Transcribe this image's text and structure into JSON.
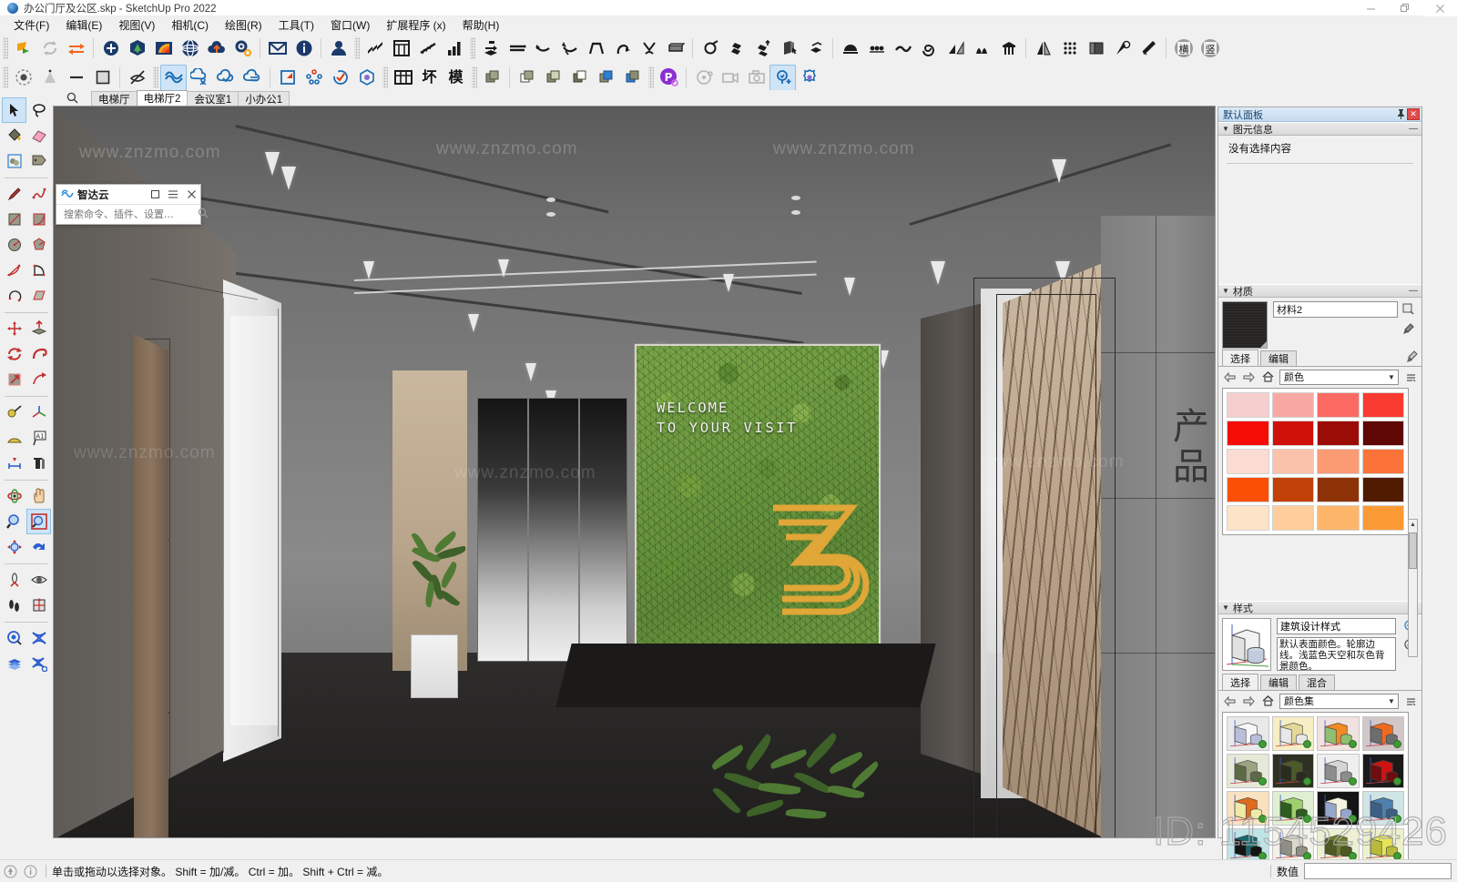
{
  "window": {
    "title": "办公门厅及公区.skp - SketchUp Pro 2022",
    "app_icon": "sketchup-app-icon",
    "minimize": "minimize-icon",
    "maximize": "restore-icon",
    "close": "close-icon"
  },
  "menu": [
    {
      "label": "文件(F)",
      "name": "menu-file"
    },
    {
      "label": "编辑(E)",
      "name": "menu-edit"
    },
    {
      "label": "视图(V)",
      "name": "menu-view"
    },
    {
      "label": "相机(C)",
      "name": "menu-camera"
    },
    {
      "label": "绘图(R)",
      "name": "menu-draw"
    },
    {
      "label": "工具(T)",
      "name": "menu-tools"
    },
    {
      "label": "窗口(W)",
      "name": "menu-window"
    },
    {
      "label": "扩展程序 (x)",
      "name": "menu-extensions"
    },
    {
      "label": "帮助(H)",
      "name": "menu-help"
    }
  ],
  "toolbar_row1": [
    {
      "name": "trimble-connect-icon",
      "glyph": "logo-green"
    },
    {
      "name": "sync-icon",
      "glyph": "refresh"
    },
    {
      "name": "transfer-icon",
      "glyph": "arrows-lr"
    },
    {
      "sep": true
    },
    {
      "name": "add-location-icon",
      "glyph": "plus-circle"
    },
    {
      "name": "tree-icon",
      "glyph": "tree"
    },
    {
      "name": "color-fan-icon",
      "glyph": "fan"
    },
    {
      "name": "globe-icon",
      "glyph": "globe"
    },
    {
      "name": "cloud-upload-icon",
      "glyph": "cloud-up"
    },
    {
      "name": "settings-icon",
      "glyph": "gears"
    },
    {
      "sep": true
    },
    {
      "name": "mail-icon",
      "glyph": "envelope"
    },
    {
      "name": "info-icon",
      "glyph": "info"
    },
    {
      "sep": true
    },
    {
      "name": "account-icon",
      "glyph": "person"
    },
    {
      "sep": true
    },
    {
      "name": "stairs-tool-icon",
      "glyph": "stairs"
    },
    {
      "name": "window-tool-icon",
      "glyph": "window"
    },
    {
      "name": "railing-tool-icon",
      "glyph": "railing"
    },
    {
      "name": "bar-chart-icon",
      "glyph": "bars"
    },
    {
      "sep": true
    },
    {
      "name": "joint-push-pull-icon",
      "glyph": "jpp"
    },
    {
      "name": "extrude-lines-icon",
      "glyph": "ext-lines"
    },
    {
      "name": "curve-tool-icon",
      "glyph": "curve1"
    },
    {
      "name": "curve-tool2-icon",
      "glyph": "curve2"
    },
    {
      "name": "shape-bender-icon",
      "glyph": "bender"
    },
    {
      "name": "loop-tool-icon",
      "glyph": "loop"
    },
    {
      "name": "weld-icon",
      "glyph": "weld"
    },
    {
      "name": "slab-icon",
      "glyph": "slab"
    },
    {
      "sep": true
    },
    {
      "name": "round-corner-icon",
      "glyph": "round"
    },
    {
      "name": "offset-faces-icon",
      "glyph": "offset-faces"
    },
    {
      "name": "face-tools-icon",
      "glyph": "face-tools"
    },
    {
      "name": "solid-select-icon",
      "glyph": "solid-sel"
    },
    {
      "name": "flatten-icon",
      "glyph": "flatten"
    },
    {
      "sep": true
    },
    {
      "name": "arch-tool-icon",
      "glyph": "arch"
    },
    {
      "name": "dots-tool-icon",
      "glyph": "dots3"
    },
    {
      "name": "wave-tool-icon",
      "glyph": "wave"
    },
    {
      "name": "spiral-tool-icon",
      "glyph": "spiral"
    },
    {
      "name": "slope-tool-icon",
      "glyph": "slope"
    },
    {
      "name": "fin-tool-icon",
      "glyph": "fin"
    },
    {
      "name": "column-tool-icon",
      "glyph": "column"
    },
    {
      "sep": true
    },
    {
      "name": "mirror-icon",
      "glyph": "mirror"
    },
    {
      "name": "array-icon",
      "glyph": "grid-dots"
    },
    {
      "name": "copy-along-icon",
      "glyph": "copy-along"
    },
    {
      "name": "rotate-axis-icon",
      "glyph": "rot-axis"
    },
    {
      "name": "cleanup-icon",
      "glyph": "broom"
    },
    {
      "sep": true
    },
    {
      "name": "model-badge-icon",
      "glyph": "cjk-mo"
    },
    {
      "name": "tool-badge-icon",
      "glyph": "cjk-tu"
    }
  ],
  "toolbar_row2": [
    {
      "name": "shadow-settings-icon",
      "glyph": "shadow-dot"
    },
    {
      "name": "fog-icon",
      "glyph": "cone"
    },
    {
      "name": "line-style-icon",
      "glyph": "line"
    },
    {
      "name": "face-style-icon",
      "glyph": "square"
    },
    {
      "sep": true
    },
    {
      "name": "hide-icon",
      "glyph": "eye-off"
    },
    {
      "sep": true
    },
    {
      "name": "enscape-start-icon",
      "glyph": "ens-wave",
      "active": true
    },
    {
      "name": "enscape-assets-icon",
      "glyph": "ens-asset"
    },
    {
      "name": "enscape-upload-icon",
      "glyph": "ens-up"
    },
    {
      "name": "enscape-settings-icon",
      "glyph": "ens-set"
    },
    {
      "sep": true
    },
    {
      "name": "render-region-icon",
      "glyph": "region"
    },
    {
      "name": "material-editor-icon",
      "glyph": "mat-dots"
    },
    {
      "name": "sync-views-icon",
      "glyph": "sync-check"
    },
    {
      "name": "asset-library-icon",
      "glyph": "cube-hex"
    },
    {
      "sep": true
    },
    {
      "name": "table-tool-icon",
      "glyph": "cjk-tbl"
    },
    {
      "name": "bad-face-icon",
      "glyph": "cjk-huai"
    },
    {
      "name": "model-tool-icon",
      "glyph": "cjk-mo2"
    },
    {
      "sep": true
    },
    {
      "name": "component-icon",
      "glyph": "comp1"
    },
    {
      "sep": true
    },
    {
      "name": "component-edit-icon",
      "glyph": "comp2"
    },
    {
      "name": "component-copy-icon",
      "glyph": "comp3"
    },
    {
      "name": "component-replace-icon",
      "glyph": "comp4"
    },
    {
      "name": "component-blue-icon",
      "glyph": "comp5"
    },
    {
      "name": "component-blue2-icon",
      "glyph": "comp6"
    },
    {
      "sep": true
    },
    {
      "name": "piranesi-icon",
      "glyph": "p-circle"
    },
    {
      "sep": true
    },
    {
      "name": "animate-icon",
      "glyph": "anim"
    },
    {
      "name": "video-export-icon",
      "glyph": "video"
    },
    {
      "name": "snapshot-icon",
      "glyph": "camera"
    },
    {
      "name": "light-add-icon",
      "glyph": "bulb-plus",
      "active": true
    },
    {
      "name": "ies-light-icon",
      "glyph": "flower"
    }
  ],
  "left_tools": [
    {
      "name": "select-tool",
      "glyph": "arrow",
      "active": true
    },
    {
      "name": "lasso-select-tool",
      "glyph": "lasso"
    },
    {
      "name": "paint-bucket-tool",
      "glyph": "bucket"
    },
    {
      "name": "eraser-tool",
      "glyph": "eraser"
    },
    {
      "name": "component-tool",
      "glyph": "component"
    },
    {
      "name": "tag-tool",
      "glyph": "tag"
    },
    {
      "sep": true
    },
    {
      "name": "line-tool",
      "glyph": "pencil"
    },
    {
      "name": "freehand-tool",
      "glyph": "freehand"
    },
    {
      "name": "rectangle-tool",
      "glyph": "rect"
    },
    {
      "name": "rotated-rectangle-tool",
      "glyph": "rot-rect"
    },
    {
      "name": "circle-tool",
      "glyph": "circle"
    },
    {
      "name": "polygon-tool",
      "glyph": "polygon"
    },
    {
      "name": "arc-tool",
      "glyph": "arc"
    },
    {
      "name": "pie-tool",
      "glyph": "pie"
    },
    {
      "name": "two-point-arc-tool",
      "glyph": "arc2"
    },
    {
      "name": "sandbox-tool",
      "glyph": "sandbox"
    },
    {
      "sep": true
    },
    {
      "name": "move-tool",
      "glyph": "move"
    },
    {
      "name": "push-pull-tool",
      "glyph": "pushpull"
    },
    {
      "name": "rotate-tool",
      "glyph": "rotate"
    },
    {
      "name": "follow-me-tool",
      "glyph": "followme"
    },
    {
      "name": "scale-tool",
      "glyph": "scale"
    },
    {
      "name": "offset-tool",
      "glyph": "offset"
    },
    {
      "sep": true
    },
    {
      "name": "tape-measure-tool",
      "glyph": "tape"
    },
    {
      "name": "axes-tool",
      "glyph": "axes"
    },
    {
      "name": "protractor-tool",
      "glyph": "protractor"
    },
    {
      "name": "text-tool",
      "glyph": "text"
    },
    {
      "name": "dimension-tool",
      "glyph": "dim"
    },
    {
      "name": "3d-text-tool",
      "glyph": "text3d"
    },
    {
      "sep": true
    },
    {
      "name": "orbit-tool",
      "glyph": "orbit"
    },
    {
      "name": "pan-tool",
      "glyph": "pan"
    },
    {
      "name": "zoom-tool",
      "glyph": "zoom"
    },
    {
      "name": "zoom-window-tool",
      "glyph": "zoom-win",
      "active": true
    },
    {
      "name": "zoom-extents-tool",
      "glyph": "zoom-ext"
    },
    {
      "name": "previous-view-tool",
      "glyph": "prev-view"
    },
    {
      "sep": true
    },
    {
      "name": "position-camera-tool",
      "glyph": "pos-cam"
    },
    {
      "name": "look-around-tool",
      "glyph": "look"
    },
    {
      "name": "walk-tool",
      "glyph": "walk"
    },
    {
      "name": "section-plane-tool",
      "glyph": "section"
    },
    {
      "sep": true
    },
    {
      "name": "solid-tools-icon",
      "glyph": "solid-tools"
    },
    {
      "name": "intersect-icon",
      "glyph": "intersect"
    },
    {
      "name": "layers-icon",
      "glyph": "layers"
    },
    {
      "name": "intersect-settings-icon",
      "glyph": "intersect2"
    }
  ],
  "scene_tabs": {
    "search_icon": "search-icon",
    "items": [
      {
        "label": "电梯厅",
        "active": false
      },
      {
        "label": "电梯厅2",
        "active": true
      },
      {
        "label": "会议室1",
        "active": false
      },
      {
        "label": "小办公1",
        "active": false
      }
    ]
  },
  "zhidayun_panel": {
    "title": "智达云",
    "logo_icon": "cloud-wave-icon",
    "restore_icon": "restore-icon",
    "menu_icon": "hamburger-icon",
    "close_icon": "close-icon",
    "search_placeholder": "搜索命令、插件、设置...",
    "search_value": "",
    "search_icon": "search-icon"
  },
  "viewport": {
    "wall_text_line1": "WELCOME",
    "wall_text_line2": "TO YOUR VISIT",
    "wall_numeral": "3",
    "watermarks": [
      "www.znzmo.com",
      "www.znzmo.com",
      "www.znzmo.com",
      "www.znzmo.com",
      "www.znzmo.com",
      "www.znzmo.com"
    ]
  },
  "tray": {
    "title": "默认面板",
    "pin_icon": "pin-icon",
    "close_icon": "close-icon",
    "entity_info": {
      "title": "图元信息",
      "collapse_icon": "triangle-down-icon",
      "minimize_icon": "minus-icon",
      "empty_text": "没有选择内容"
    },
    "materials": {
      "title": "材质",
      "collapse_icon": "triangle-down-icon",
      "minimize_icon": "minus-icon",
      "thumb_name": "material-preview-dark",
      "name_value": "材料2",
      "create_icon": "create-material-icon",
      "sample_icon": "eyedropper-icon",
      "tabs": [
        {
          "label": "选择",
          "active": true
        },
        {
          "label": "编辑",
          "active": false
        }
      ],
      "tab_right_icon": "eyedropper-icon",
      "nav": {
        "back_icon": "arrow-left-icon",
        "forward_icon": "arrow-right-icon",
        "home_icon": "home-icon",
        "library_value": "颜色",
        "caret_icon": "chevron-down-icon",
        "details_icon": "details-icon"
      },
      "swatches": [
        "#f5cfce",
        "#f7a8a3",
        "#fb6b64",
        "#f93a30",
        "#f50d05",
        "#cf1109",
        "#9c0c06",
        "#5e0703",
        "#fbdcd2",
        "#fbc2ab",
        "#fb9b73",
        "#fb7338",
        "#fb4f06",
        "#c24108",
        "#8d3206",
        "#4f1c02",
        "#fde4c9",
        "#fdcd9b",
        "#fdb56a",
        "#fb9a34"
      ],
      "scrollbar": {
        "up_icon": "arrow-up-icon",
        "down_icon": "arrow-down-icon"
      }
    },
    "styles": {
      "title": "样式",
      "collapse_icon": "triangle-down-icon",
      "minimize_icon": "minus-icon",
      "name_value": "建筑设计样式",
      "description": "默认表面颜色。轮廓边线。浅蓝色天空和灰色背景颜色。",
      "create_icon": "create-style-icon",
      "update_icon": "update-style-icon",
      "tabs": [
        {
          "label": "选择",
          "active": true
        },
        {
          "label": "编辑",
          "active": false
        },
        {
          "label": "混合",
          "active": false
        }
      ],
      "nav": {
        "back_icon": "arrow-left-icon",
        "forward_icon": "arrow-right-icon",
        "home_icon": "home-icon",
        "library_value": "颜色集",
        "caret_icon": "chevron-down-icon",
        "details_icon": "details-icon"
      },
      "thumbnails": [
        {
          "bg": "#e9e9e9",
          "box": "#f7f7f7",
          "cyl": "#b9bfd8"
        },
        {
          "bg": "#f6eec4",
          "box": "#e3d89a",
          "cyl": "#e8e8e8"
        },
        {
          "bg": "#f0e2df",
          "box": "#f08a22",
          "cyl": "#8fbf72"
        },
        {
          "bg": "#d2c6c7",
          "box": "#ef6a21",
          "cyl": "#6d6d6d"
        },
        {
          "bg": "#e7e9d8",
          "box": "#9aa481",
          "cyl": "#5c6b46"
        },
        {
          "bg": "#2e3122",
          "box": "#4c5a2a",
          "cyl": "#2a2c20"
        },
        {
          "bg": "#efefef",
          "box": "#d5d5d5",
          "cyl": "#8d8d8d"
        },
        {
          "bg": "#1a1a1a",
          "box": "#cf1212",
          "cyl": "#6e0d0d"
        },
        {
          "bg": "#fae2c0",
          "box": "#e06a1d",
          "cyl": "#eeeaa8"
        },
        {
          "bg": "#dff0d2",
          "box": "#9fd06b",
          "cyl": "#2f5c1f"
        },
        {
          "bg": "#141414",
          "box": "#f3f1df",
          "cyl": "#95a6cb"
        },
        {
          "bg": "#cfe4e4",
          "box": "#4e7fae",
          "cyl": "#3d5f85"
        },
        {
          "bg": "#bfe4e8",
          "box": "#18686e",
          "cyl": "#141414"
        },
        {
          "bg": "#f2f2ea",
          "box": "#d8d8cc",
          "cyl": "#8f8f84"
        },
        {
          "bg": "#eef0d4",
          "box": "#6f7f30",
          "cyl": "#4e5a22"
        },
        {
          "bg": "#eef2cc",
          "box": "#e8e45a",
          "cyl": "#b9b93c"
        }
      ]
    }
  },
  "statusbar": {
    "geo_icon": "geo-location-icon",
    "credits_icon": "info-circle-icon",
    "hint": "单击或拖动以选择对象。 Shift = 加/减。 Ctrl = 加。 Shift + Ctrl = 减。",
    "vcb_label": "数值",
    "vcb_value": "",
    "vcb_placeholder": ""
  },
  "watermark": {
    "id_text": "ID: 1154529426",
    "site": "www.znzmo.com"
  }
}
